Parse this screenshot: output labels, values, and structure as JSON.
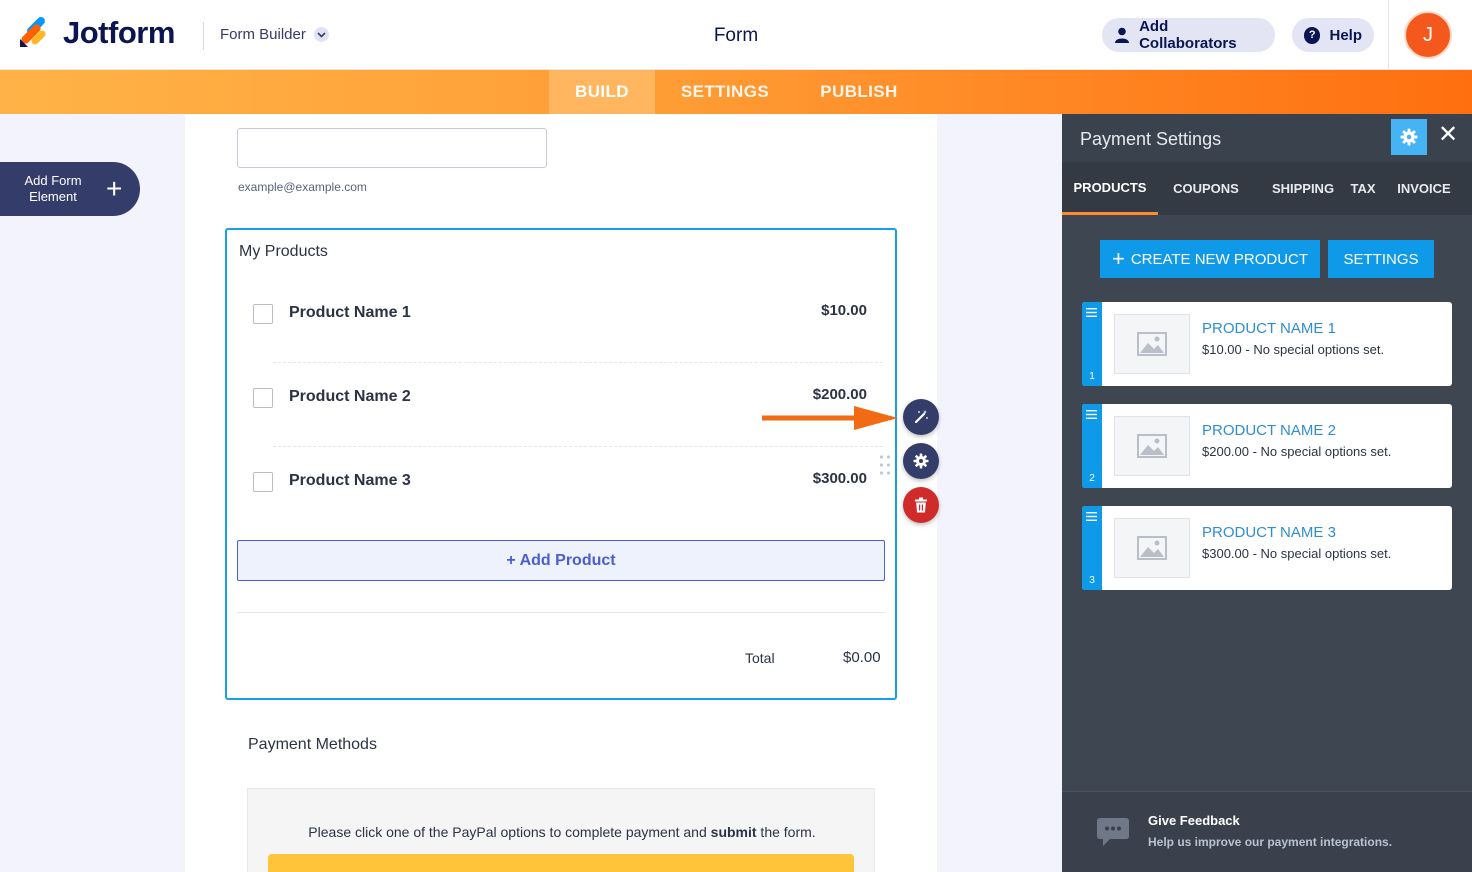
{
  "app": {
    "brand": "Jotform",
    "builder_label": "Form Builder",
    "form_title": "Form"
  },
  "header": {
    "collaborators_label": "Add Collaborators",
    "help_label": "Help",
    "avatar_initial": "J"
  },
  "nav": {
    "tabs": [
      {
        "label": "BUILD",
        "active": true
      },
      {
        "label": "SETTINGS",
        "active": false
      },
      {
        "label": "PUBLISH",
        "active": false
      }
    ]
  },
  "sidebar": {
    "add_element_label": "Add Form Element"
  },
  "form": {
    "email_hint": "example@example.com",
    "products_title": "My Products",
    "products": [
      {
        "name": "Product Name 1",
        "price": "$10.00"
      },
      {
        "name": "Product Name 2",
        "price": "$200.00"
      },
      {
        "name": "Product Name 3",
        "price": "$300.00"
      }
    ],
    "add_product_label": "+ Add Product",
    "total_label": "Total",
    "total_value": "$0.00",
    "payment_methods_title": "Payment Methods",
    "paypal_text_pre": "Please click one of the PayPal options to complete payment and ",
    "paypal_text_bold": "submit",
    "paypal_text_post": " the form."
  },
  "panel": {
    "title": "Payment Settings",
    "tabs": [
      {
        "label": "PRODUCTS",
        "active": true
      },
      {
        "label": "COUPONS",
        "active": false
      },
      {
        "label": "SHIPPING",
        "active": false
      },
      {
        "label": "TAX",
        "active": false
      },
      {
        "label": "INVOICE",
        "active": false
      }
    ],
    "create_label": "CREATE NEW PRODUCT",
    "settings_label": "SETTINGS",
    "products": [
      {
        "index": "1",
        "name": "PRODUCT NAME 1",
        "desc": "$10.00 - No special options set."
      },
      {
        "index": "2",
        "name": "PRODUCT NAME 2",
        "desc": "$200.00 - No special options set."
      },
      {
        "index": "3",
        "name": "PRODUCT NAME 3",
        "desc": "$300.00 - No special options set."
      }
    ],
    "feedback_title": "Give Feedback",
    "feedback_sub": "Help us improve our payment integrations."
  },
  "colors": {
    "brand_navy": "#0a1551",
    "nav_orange": "#ff6f10",
    "accent_blue": "#0e9ae9",
    "selection_blue": "#18a0e6",
    "delete_red": "#d02b2b",
    "arrow_orange": "#f26a12"
  },
  "icons": {
    "logo": "jotform-logo-icon",
    "collaborators": "user-icon",
    "help": "question-icon",
    "wand": "magic-wand-icon",
    "gear": "gear-icon",
    "trash": "trash-icon",
    "close": "close-icon",
    "feedback": "chat-bubble-icon"
  }
}
